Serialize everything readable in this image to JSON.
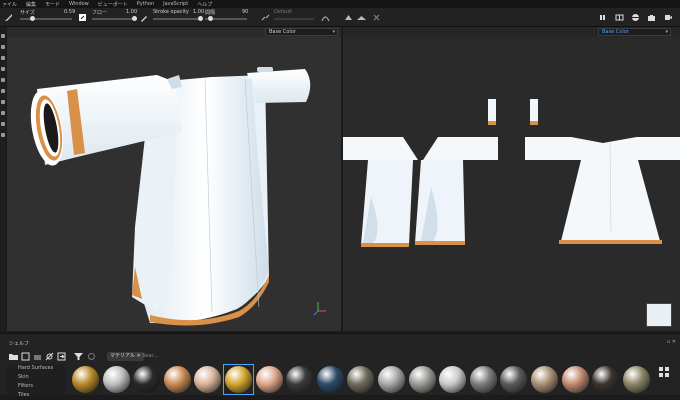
{
  "menubar": {
    "items": [
      "ァイル",
      "編集",
      "モード",
      "Window",
      "ビューポート",
      "Python",
      "JavaScript",
      "ヘルプ"
    ]
  },
  "toolbar": {
    "size_label": "サイズ",
    "size_value": "0.59",
    "flow_label": "フロー",
    "flow_value": "1.00",
    "stroke_opacity_label": "Stroke opacity",
    "stroke_opacity_value": "1.00",
    "spacing_label": "間隔",
    "spacing_value": "90",
    "preset_label": "Default",
    "icons": [
      "brush-icon",
      "eraser-icon",
      "symmetry-icon",
      "lazy-mouse-icon",
      "curve-icon",
      "pause-icon",
      "camera-icon",
      "video-icon"
    ]
  },
  "viewport3d": {
    "channel": "Base Color",
    "axis_labels": {
      "x": "x",
      "y": "y",
      "z": "z"
    }
  },
  "viewport2d": {
    "channel": "Base Color"
  },
  "shelf": {
    "title": "シェルフ",
    "filter_tag": "マテリアル",
    "filter_tag_close": "✕",
    "search_placeholder": "Sear...",
    "categories": [
      "Hard Surfaces",
      "Skin",
      "Filters",
      "Tiles"
    ],
    "materials": [
      {
        "name": "gold-rough",
        "color": "#b8892a"
      },
      {
        "name": "chrome",
        "color": "#bfbfbf"
      },
      {
        "name": "black-plastic",
        "color": "#2a2a2a"
      },
      {
        "name": "leaf",
        "color": "#c88a55"
      },
      {
        "name": "skin-pale",
        "color": "#d9b49a"
      },
      {
        "name": "gold",
        "color": "#d3a52e"
      },
      {
        "name": "skin",
        "color": "#dca58a"
      },
      {
        "name": "dark-metal",
        "color": "#3a3a3a"
      },
      {
        "name": "fabric-blue",
        "color": "#2c4a6a"
      },
      {
        "name": "concrete",
        "color": "#6f6a5c"
      },
      {
        "name": "silver",
        "color": "#a8a8a8"
      },
      {
        "name": "stone",
        "color": "#9b9b96"
      },
      {
        "name": "white-plastic",
        "color": "#c9c9c9"
      },
      {
        "name": "gray-rubber",
        "color": "#7d7d7d"
      },
      {
        "name": "gunmetal",
        "color": "#5a5a5a"
      },
      {
        "name": "tan-leather",
        "color": "#a89074"
      },
      {
        "name": "copper",
        "color": "#c08a70"
      },
      {
        "name": "black-metal",
        "color": "#3b332c"
      },
      {
        "name": "olive",
        "color": "#8c8566"
      }
    ],
    "selected_index": 5
  },
  "colors": {
    "accent": "#4aa3ff",
    "garment": "#eef5fa",
    "trim": "#d9914a",
    "background": "#303030"
  }
}
